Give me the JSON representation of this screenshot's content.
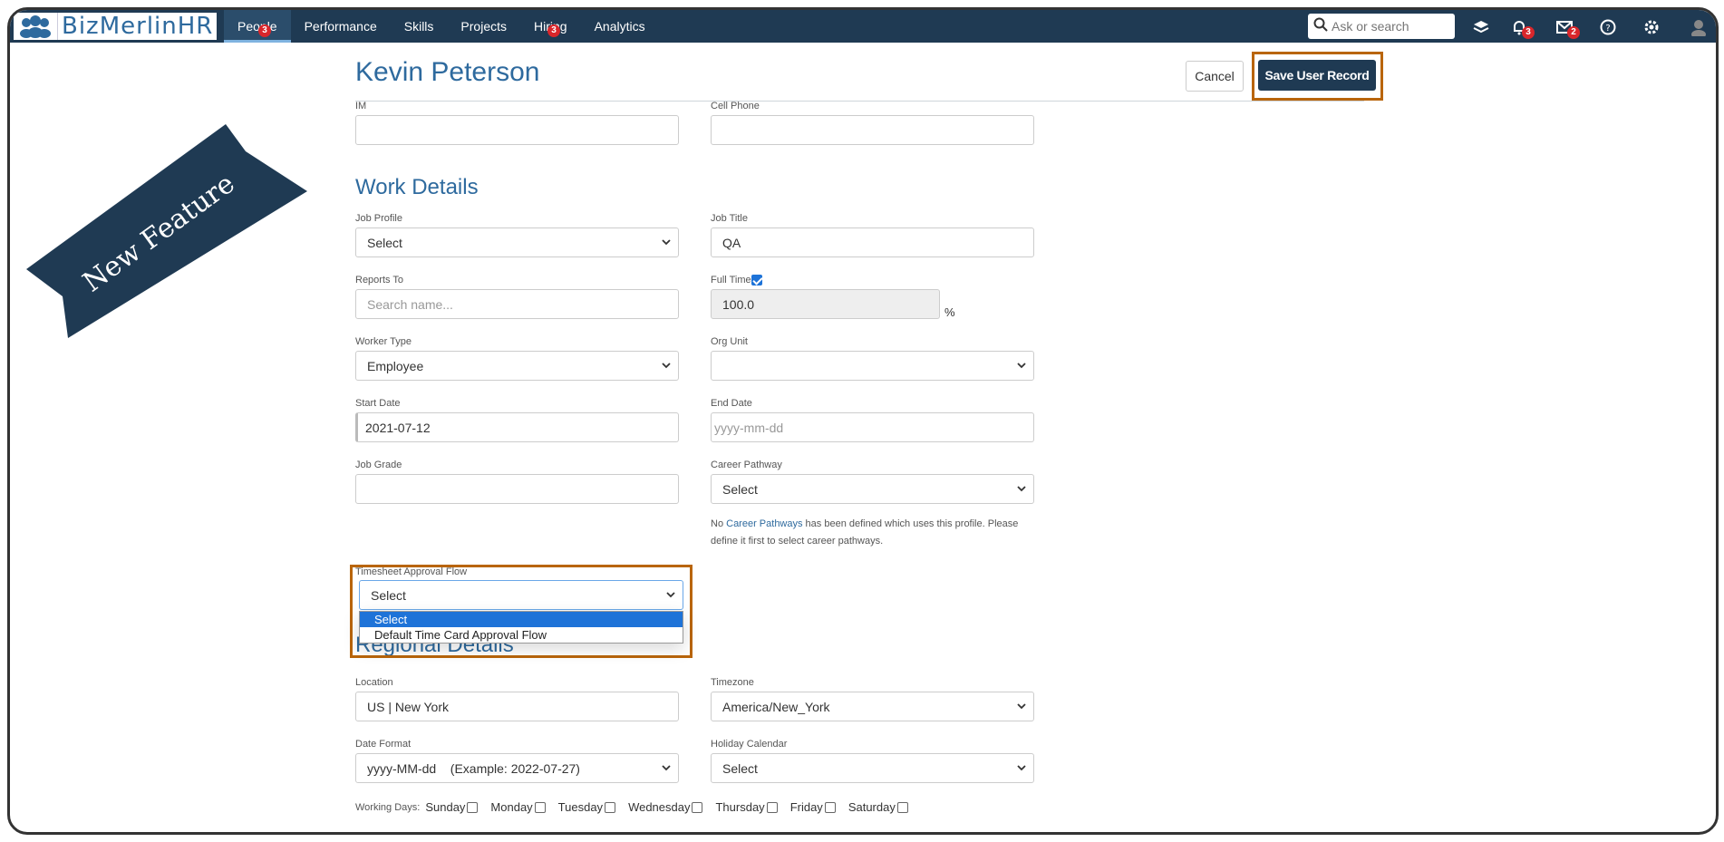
{
  "app": {
    "logo_text": "BizMerlinHR"
  },
  "nav": {
    "items": [
      {
        "label": "People",
        "badge": "3"
      },
      {
        "label": "Performance",
        "badge": ""
      },
      {
        "label": "Skills",
        "badge": ""
      },
      {
        "label": "Projects",
        "badge": ""
      },
      {
        "label": "Hiring",
        "badge": "3"
      },
      {
        "label": "Analytics",
        "badge": ""
      }
    ],
    "search_placeholder": "Ask or search",
    "notifications_badge": "3",
    "messages_badge": "2"
  },
  "ribbon_text": "New Feature",
  "header": {
    "name": "Kevin Peterson",
    "cancel_label": "Cancel",
    "save_label": "Save User Record"
  },
  "contact": {
    "im_label": "IM",
    "im_value": "",
    "cell_label": "Cell Phone",
    "cell_value": ""
  },
  "work": {
    "title": "Work Details",
    "job_profile_label": "Job Profile",
    "job_profile_value": "Select",
    "job_title_label": "Job Title",
    "job_title_value": "QA",
    "reports_to_label": "Reports To",
    "reports_to_placeholder": "Search name...",
    "full_time_label": "Full Time",
    "full_time_checked": true,
    "full_time_value": "100.0",
    "percent_sign": "%",
    "worker_type_label": "Worker Type",
    "worker_type_value": "Employee",
    "org_unit_label": "Org Unit",
    "org_unit_value": "",
    "start_date_label": "Start Date",
    "start_date_value": "2021-07-12",
    "end_date_label": "End Date",
    "end_date_placeholder": "yyyy-mm-dd",
    "job_grade_label": "Job Grade",
    "job_grade_value": "",
    "career_pathway_label": "Career Pathway",
    "career_pathway_value": "Select",
    "career_note_pre": "No ",
    "career_note_link": "Career Pathways",
    "career_note_post": " has been defined which uses this profile. Please define it first to select career pathways.",
    "timesheet_label": "Timesheet Approval Flow",
    "timesheet_value": "Select",
    "timesheet_options": [
      "Select",
      "Default Time Card Approval Flow"
    ]
  },
  "regional": {
    "title": "Regional Details",
    "location_label": "Location",
    "location_value": "US | New York",
    "timezone_label": "Timezone",
    "timezone_value": "America/New_York",
    "date_format_label": "Date Format",
    "date_format_value": "yyyy-MM-dd    (Example: 2022-07-27)",
    "holiday_label": "Holiday Calendar",
    "holiday_value": "Select",
    "working_days_label": "Working Days:",
    "days": [
      "Sunday",
      "Monday",
      "Tuesday",
      "Wednesday",
      "Thursday",
      "Friday",
      "Saturday"
    ]
  },
  "colors": {
    "nav_bg": "#1f3a53",
    "accent": "#2e6a9e",
    "highlight": "#b9650b",
    "ribbon": "#1f3a53"
  }
}
